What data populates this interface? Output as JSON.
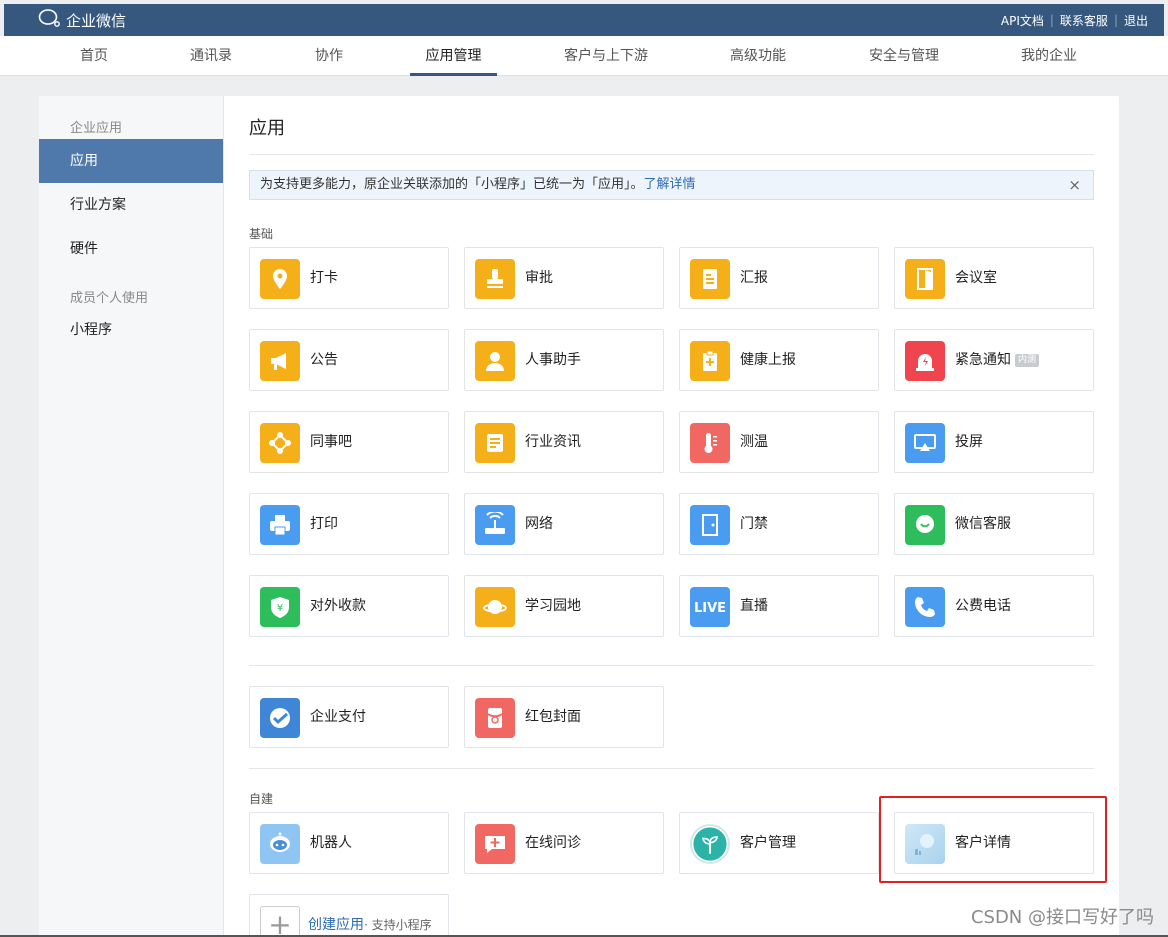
{
  "topbar": {
    "brand": "企业微信",
    "links": [
      "API文档",
      "联系客服",
      "退出"
    ]
  },
  "nav": {
    "items": [
      "首页",
      "通讯录",
      "协作",
      "应用管理",
      "客户与上下游",
      "高级功能",
      "安全与管理",
      "我的企业"
    ],
    "active": "应用管理"
  },
  "sidebar": {
    "group1": "企业应用",
    "items1": [
      "应用",
      "行业方案",
      "硬件"
    ],
    "group2": "成员个人使用",
    "items2": [
      "小程序"
    ]
  },
  "main": {
    "title": "应用",
    "notice": {
      "text": "为支持更多能力，原企业关联添加的「小程序」已统一为「应用」。",
      "link": "了解详情",
      "close": "×"
    },
    "basic_label": "基础",
    "basic_apps": [
      {
        "name": "打卡",
        "icon": "location-pin-icon"
      },
      {
        "name": "审批",
        "icon": "stamp-icon"
      },
      {
        "name": "汇报",
        "icon": "report-icon"
      },
      {
        "name": "会议室",
        "icon": "door-icon"
      },
      {
        "name": "公告",
        "icon": "megaphone-icon"
      },
      {
        "name": "人事助手",
        "icon": "person-icon"
      },
      {
        "name": "健康上报",
        "icon": "clipboard-plus-icon"
      },
      {
        "name": "紧急通知",
        "icon": "alarm-icon",
        "tag": "内测"
      },
      {
        "name": "同事吧",
        "icon": "network-icon"
      },
      {
        "name": "行业资讯",
        "icon": "scroll-icon"
      },
      {
        "name": "测温",
        "icon": "thermometer-icon"
      },
      {
        "name": "投屏",
        "icon": "screen-cast-icon"
      },
      {
        "name": "打印",
        "icon": "printer-icon"
      },
      {
        "name": "网络",
        "icon": "router-icon"
      },
      {
        "name": "门禁",
        "icon": "door-access-icon"
      },
      {
        "name": "微信客服",
        "icon": "chat-bubble-icon"
      },
      {
        "name": "对外收款",
        "icon": "yuan-shield-icon"
      },
      {
        "name": "学习园地",
        "icon": "planet-icon"
      },
      {
        "name": "直播",
        "icon": "live-icon"
      },
      {
        "name": "公费电话",
        "icon": "phone-icon"
      }
    ],
    "extra_apps": [
      {
        "name": "企业支付",
        "icon": "payment-check-icon"
      },
      {
        "name": "红包封面",
        "icon": "red-packet-icon"
      }
    ],
    "custom_label": "自建",
    "custom_apps": [
      {
        "name": "机器人",
        "icon": "robot-icon"
      },
      {
        "name": "在线问诊",
        "icon": "medical-chat-icon"
      },
      {
        "name": "客户管理",
        "icon": "sprout-icon"
      },
      {
        "name": "客户详情",
        "icon": "landscape-image-icon"
      }
    ],
    "create": {
      "link": "创建应用",
      "sub": "· 支持小程序"
    }
  },
  "watermark": "CSDN @接口写好了吗",
  "colors": {
    "topbar": "#36587f",
    "active_side": "#4f79ab",
    "link": "#2d6bb5",
    "highlight": "#e51f1f"
  }
}
